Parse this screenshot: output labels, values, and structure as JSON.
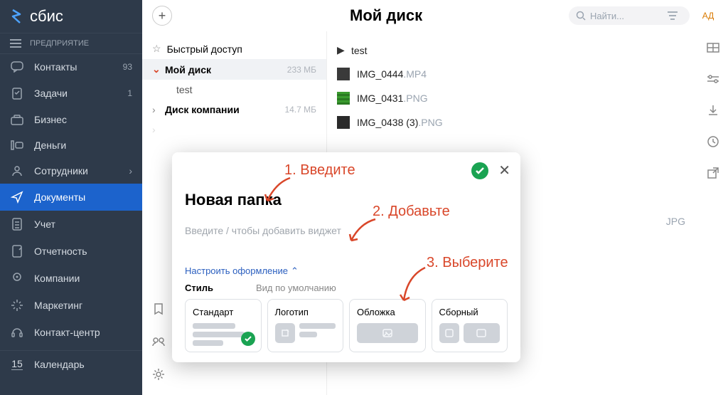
{
  "app": {
    "name": "сбис",
    "org": "ПРЕДПРИЯТИЕ",
    "avatar": "АД"
  },
  "search": {
    "placeholder": "Найти..."
  },
  "nav": {
    "items": [
      {
        "label": "Контакты",
        "badge": "93"
      },
      {
        "label": "Задачи",
        "badge": "1"
      },
      {
        "label": "Бизнес"
      },
      {
        "label": "Деньги"
      },
      {
        "label": "Сотрудники"
      },
      {
        "label": "Документы"
      },
      {
        "label": "Учет"
      },
      {
        "label": "Отчетность"
      },
      {
        "label": "Компании"
      },
      {
        "label": "Маркетинг"
      },
      {
        "label": "Контакт-центр"
      },
      {
        "label": "Календарь"
      }
    ],
    "calendar_count": "15"
  },
  "header_title": "Мой диск",
  "tree": {
    "quick": "Быстрый доступ",
    "mydisk": {
      "label": "Мой диск",
      "size": "233 МБ"
    },
    "mydisk_sub": "test",
    "company": {
      "label": "Диск компании",
      "size": "14.7 МБ"
    }
  },
  "files": {
    "folder": "test",
    "items": [
      {
        "name": "IMG_0444",
        "ext": ".MP4",
        "thumb": "#3a3a3a"
      },
      {
        "name": "IMG_0431",
        "ext": ".PNG",
        "thumb": "#3a9b2e"
      },
      {
        "name": "IMG_0438 (3)",
        "ext": ".PNG",
        "thumb": "#2a2a2a"
      }
    ],
    "hidden_item": {
      "ext": "JPG"
    }
  },
  "modal": {
    "title": "Новая папка",
    "widget_placeholder": "Введите / чтобы добавить виджет",
    "configure": "Настроить оформление",
    "labels": {
      "style": "Стиль",
      "default_view": "Вид по умолчанию"
    },
    "cards": [
      "Стандарт",
      "Логотип",
      "Обложка",
      "Сборный"
    ]
  },
  "annotations": {
    "a1": "1. Введите",
    "a2": "2. Добавьте",
    "a3": "3. Выберите"
  },
  "add_tooltip": "+"
}
